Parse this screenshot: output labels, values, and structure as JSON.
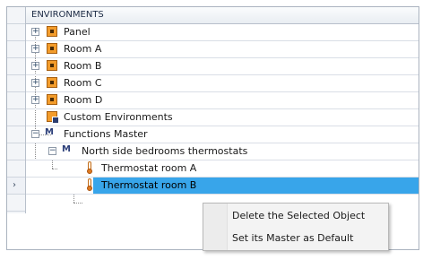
{
  "tree": {
    "header": "ENVIRONMENTS",
    "items": [
      {
        "label": "Panel"
      },
      {
        "label": "Room A"
      },
      {
        "label": "Room B"
      },
      {
        "label": "Room C"
      },
      {
        "label": "Room D"
      },
      {
        "label": "Custom Environments"
      },
      {
        "label": "Functions Master"
      },
      {
        "label": "North side bedrooms thermostats"
      },
      {
        "label": "Thermostat room A"
      },
      {
        "label": "Thermostat room B"
      }
    ],
    "current_row_indicator": "›"
  },
  "context_menu": {
    "items": [
      {
        "label": "Delete the Selected Object"
      },
      {
        "label": "Set its Master as Default"
      }
    ]
  },
  "icons": {
    "expand": "+",
    "collapse": "−",
    "master": "M",
    "room": "room-icon",
    "thermostat": "thermometer-icon"
  },
  "colors": {
    "selection": "#38a5ea",
    "room_icon": "#f39c2b"
  }
}
